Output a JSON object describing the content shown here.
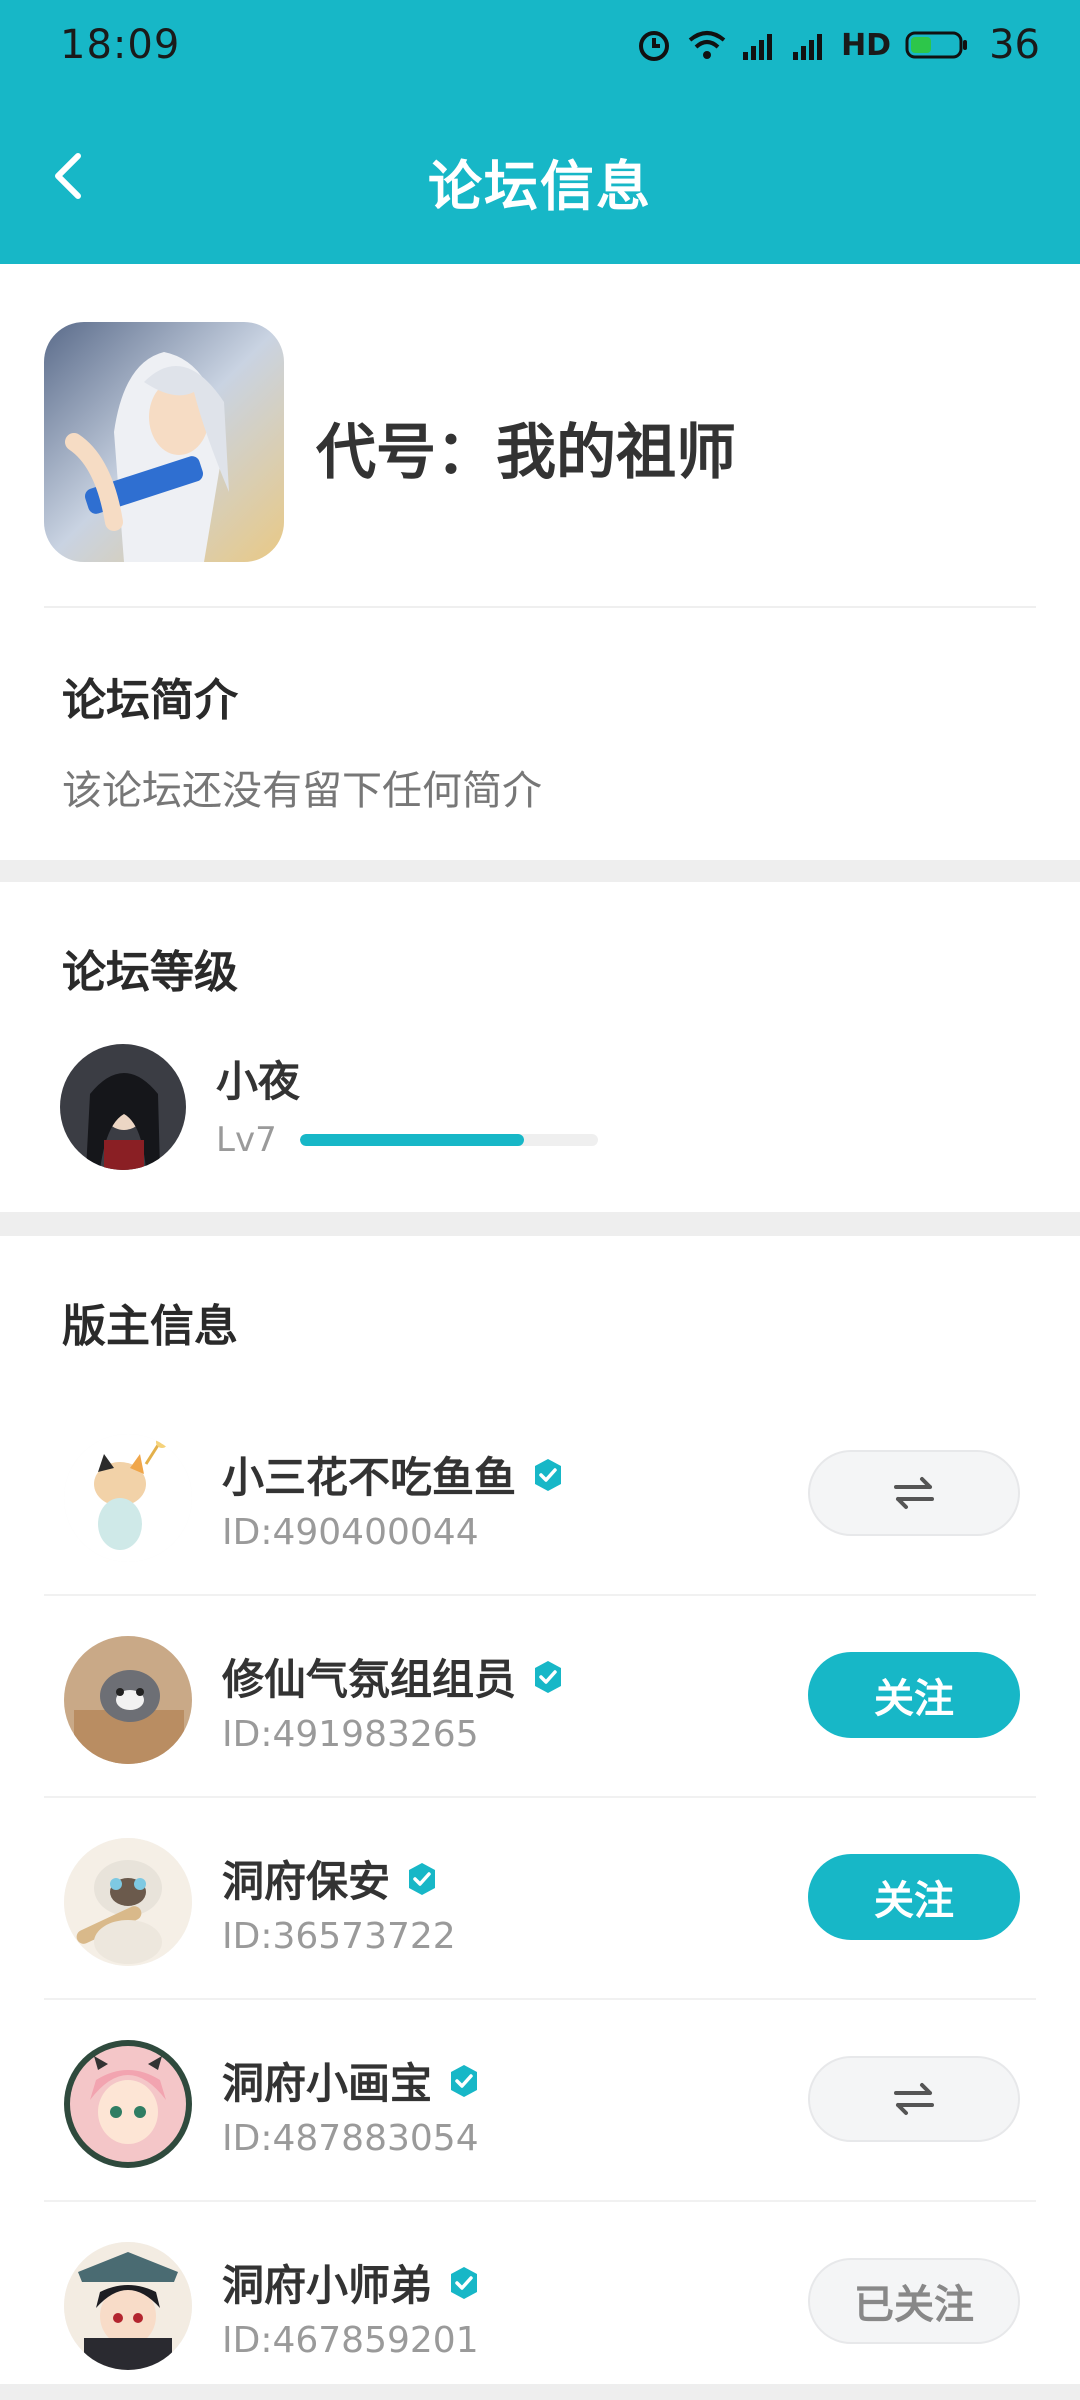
{
  "status_bar": {
    "time": "18:09",
    "network": "HD",
    "battery": "36"
  },
  "app_bar": {
    "title": "论坛信息"
  },
  "forum": {
    "name": "代号：我的祖师"
  },
  "intro": {
    "title": "论坛简介",
    "text": "该论坛还没有留下任何简介"
  },
  "level": {
    "title": "论坛等级",
    "user": "小夜",
    "level_label": "Lv7",
    "progress": 0.75
  },
  "moderators": {
    "title": "版主信息",
    "items": [
      {
        "name": "小三花不吃鱼鱼",
        "id": "ID:490400044",
        "action": "mutual",
        "action_label": "⇄"
      },
      {
        "name": "修仙气氛组组员",
        "id": "ID:491983265",
        "action": "follow",
        "action_label": "关注"
      },
      {
        "name": "洞府保安",
        "id": "ID:36573722",
        "action": "follow",
        "action_label": "关注"
      },
      {
        "name": "洞府小画宝",
        "id": "ID:487883054",
        "action": "mutual",
        "action_label": "⇄"
      },
      {
        "name": "洞府小师弟",
        "id": "ID:467859201",
        "action": "followed",
        "action_label": "已关注"
      }
    ]
  },
  "colors": {
    "accent": "#17b7c7"
  }
}
